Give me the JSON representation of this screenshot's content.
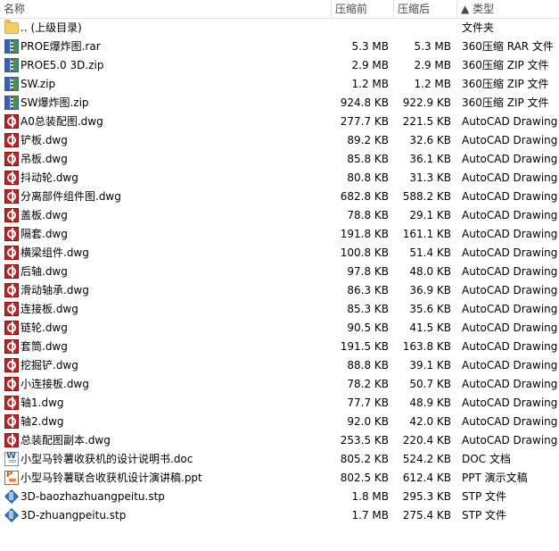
{
  "columns": {
    "name": "名称",
    "compressed": "压缩前",
    "original": "压缩后",
    "type_sort_indicator": "▲",
    "type": "类型"
  },
  "rows": [
    {
      "icon": "folder",
      "name": ".. (上级目录)",
      "compressed": "",
      "original": "",
      "type": "文件夹"
    },
    {
      "icon": "zip",
      "name": "PROE爆炸图.rar",
      "compressed": "5.3 MB",
      "original": "5.3 MB",
      "type": "360压缩 RAR 文件"
    },
    {
      "icon": "zip",
      "name": "PROE5.0 3D.zip",
      "compressed": "2.9 MB",
      "original": "2.9 MB",
      "type": "360压缩 ZIP 文件"
    },
    {
      "icon": "zip",
      "name": "SW.zip",
      "compressed": "1.2 MB",
      "original": "1.2 MB",
      "type": "360压缩 ZIP 文件"
    },
    {
      "icon": "zip",
      "name": "SW爆炸图.zip",
      "compressed": "924.8 KB",
      "original": "922.9 KB",
      "type": "360压缩 ZIP 文件"
    },
    {
      "icon": "dwg",
      "name": "A0总装配图.dwg",
      "compressed": "277.7 KB",
      "original": "221.5 KB",
      "type": "AutoCAD Drawing"
    },
    {
      "icon": "dwg",
      "name": "铲板.dwg",
      "compressed": "89.2 KB",
      "original": "32.6 KB",
      "type": "AutoCAD Drawing"
    },
    {
      "icon": "dwg",
      "name": "吊板.dwg",
      "compressed": "85.8 KB",
      "original": "36.1 KB",
      "type": "AutoCAD Drawing"
    },
    {
      "icon": "dwg",
      "name": "抖动轮.dwg",
      "compressed": "80.8 KB",
      "original": "31.3 KB",
      "type": "AutoCAD Drawing"
    },
    {
      "icon": "dwg",
      "name": "分离部件组件图.dwg",
      "compressed": "682.8 KB",
      "original": "588.2 KB",
      "type": "AutoCAD Drawing"
    },
    {
      "icon": "dwg",
      "name": "盖板.dwg",
      "compressed": "78.8 KB",
      "original": "29.1 KB",
      "type": "AutoCAD Drawing"
    },
    {
      "icon": "dwg",
      "name": "隔套.dwg",
      "compressed": "191.8 KB",
      "original": "161.1 KB",
      "type": "AutoCAD Drawing"
    },
    {
      "icon": "dwg",
      "name": "横梁组件.dwg",
      "compressed": "100.8 KB",
      "original": "51.4 KB",
      "type": "AutoCAD Drawing"
    },
    {
      "icon": "dwg",
      "name": "后轴.dwg",
      "compressed": "97.8 KB",
      "original": "48.0 KB",
      "type": "AutoCAD Drawing"
    },
    {
      "icon": "dwg",
      "name": "滑动轴承.dwg",
      "compressed": "86.3 KB",
      "original": "36.9 KB",
      "type": "AutoCAD Drawing"
    },
    {
      "icon": "dwg",
      "name": "连接板.dwg",
      "compressed": "85.3 KB",
      "original": "35.6 KB",
      "type": "AutoCAD Drawing"
    },
    {
      "icon": "dwg",
      "name": "链轮.dwg",
      "compressed": "90.5 KB",
      "original": "41.5 KB",
      "type": "AutoCAD Drawing"
    },
    {
      "icon": "dwg",
      "name": "套筒.dwg",
      "compressed": "191.5 KB",
      "original": "163.8 KB",
      "type": "AutoCAD Drawing"
    },
    {
      "icon": "dwg",
      "name": "挖掘铲.dwg",
      "compressed": "88.8 KB",
      "original": "39.1 KB",
      "type": "AutoCAD Drawing"
    },
    {
      "icon": "dwg",
      "name": "小连接板.dwg",
      "compressed": "78.2 KB",
      "original": "50.7 KB",
      "type": "AutoCAD Drawing"
    },
    {
      "icon": "dwg",
      "name": "轴1.dwg",
      "compressed": "77.7 KB",
      "original": "48.9 KB",
      "type": "AutoCAD Drawing"
    },
    {
      "icon": "dwg",
      "name": "轴2.dwg",
      "compressed": "92.0 KB",
      "original": "42.0 KB",
      "type": "AutoCAD Drawing"
    },
    {
      "icon": "dwg",
      "name": "总装配图副本.dwg",
      "compressed": "253.5 KB",
      "original": "220.4 KB",
      "type": "AutoCAD Drawing"
    },
    {
      "icon": "doc",
      "name": "小型马铃薯收获机的设计说明书.doc",
      "compressed": "805.2 KB",
      "original": "524.2 KB",
      "type": "DOC 文档"
    },
    {
      "icon": "ppt",
      "name": "小型马铃薯联合收获机设计演讲稿.ppt",
      "compressed": "802.5 KB",
      "original": "612.4 KB",
      "type": "PPT 演示文稿"
    },
    {
      "icon": "stp",
      "name": "3D-baozhazhuangpeitu.stp",
      "compressed": "1.8 MB",
      "original": "295.3 KB",
      "type": "STP 文件"
    },
    {
      "icon": "stp",
      "name": "3D-zhuangpeitu.stp",
      "compressed": "1.7 MB",
      "original": "275.4 KB",
      "type": "STP 文件"
    }
  ]
}
